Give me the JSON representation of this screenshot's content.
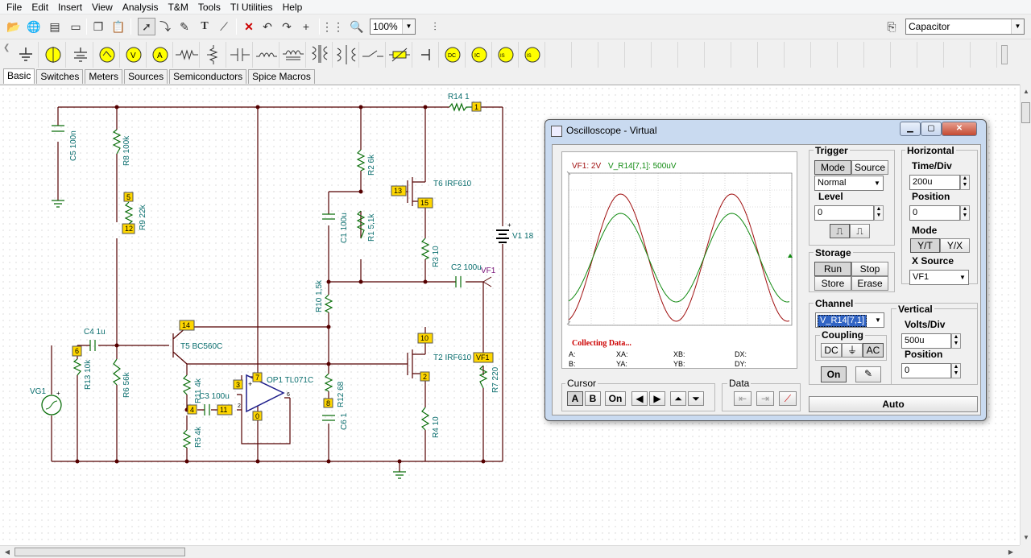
{
  "menu": [
    "File",
    "Edit",
    "Insert",
    "View",
    "Analysis",
    "T&M",
    "Tools",
    "TI Utilities",
    "Help"
  ],
  "toolbar": {
    "zoom": "100%",
    "component": "Capacitor"
  },
  "tabs": [
    "Basic",
    "Switches",
    "Meters",
    "Sources",
    "Semiconductors",
    "Spice Macros"
  ],
  "schematic": {
    "labels": {
      "r14": "R14 1",
      "c5": "C5 100n",
      "r8": "R8 100k",
      "r9": "R9 22k",
      "r2": "R2 6k",
      "t6": "T6 IRF610",
      "c1": "C1 100u",
      "r1": "R1 5,1k",
      "r3": "R3 10",
      "c2": "C2 100u",
      "v1": "V1 18",
      "vf1": "VF1",
      "r10": "R10 1,5k",
      "c4": "C4 1u",
      "t5": "T5 BC560C",
      "t2": "T2 IRF610",
      "r13": "R13 10k",
      "r6": "R6 56k",
      "r11": "R11 4k",
      "c3": "C3 100u",
      "op1": "OP1 TL071C",
      "r12": "R12 68",
      "c6": "C6 1",
      "r7": "R7 220",
      "r4": "R4 10",
      "r5": "R5 4k",
      "vg1": "VG1"
    },
    "nodes": {
      "n1": "1",
      "n5": "5",
      "n12": "12",
      "n13": "13",
      "n15": "15",
      "n14": "14",
      "n10": "10",
      "n6": "6",
      "n3": "3",
      "n7": "7",
      "n4": "4",
      "n11": "11",
      "n0": "0",
      "n8": "8",
      "n2": "2",
      "vf1": "VF1"
    },
    "pins": {
      "plus": "+",
      "p2": "2",
      "p6": "6"
    }
  },
  "scope": {
    "title": "Oscilloscope - Virtual",
    "legend_vf1": "VF1: 2V",
    "legend_r14": "V_R14[7,1]: 500uV",
    "status": "Collecting Data...",
    "readouts": {
      "a": "A:",
      "b": "B:",
      "xa": "XA:",
      "ya": "YA:",
      "xb": "XB:",
      "yb": "YB:",
      "dx": "DX:",
      "dy": "DY:"
    },
    "trigger": {
      "title": "Trigger",
      "mode": "Mode",
      "source": "Source",
      "mode_value": "Normal",
      "level_label": "Level",
      "level": "0"
    },
    "horizontal": {
      "title": "Horizontal",
      "time_label": "Time/Div",
      "time": "200u",
      "pos_label": "Position",
      "pos": "0",
      "mode_label": "Mode",
      "yt": "Y/T",
      "yx": "Y/X",
      "xsrc_label": "X Source",
      "xsrc": "VF1"
    },
    "storage": {
      "title": "Storage",
      "run": "Run",
      "stop": "Stop",
      "store": "Store",
      "erase": "Erase"
    },
    "channel": {
      "title": "Channel",
      "value": "V_R14[7,1]",
      "coupling": "Coupling",
      "dc": "DC",
      "gnd": "⏚",
      "ac": "AC",
      "on": "On"
    },
    "vertical": {
      "title": "Vertical",
      "vd_label": "Volts/Div",
      "vd": "500u",
      "pos_label": "Position",
      "pos": "0"
    },
    "cursor": {
      "title": "Cursor",
      "a": "A",
      "b": "B",
      "on": "On"
    },
    "data": {
      "title": "Data"
    },
    "auto": "Auto",
    "colors": {
      "vf1": "#a01010",
      "r14": "#108a10"
    }
  }
}
